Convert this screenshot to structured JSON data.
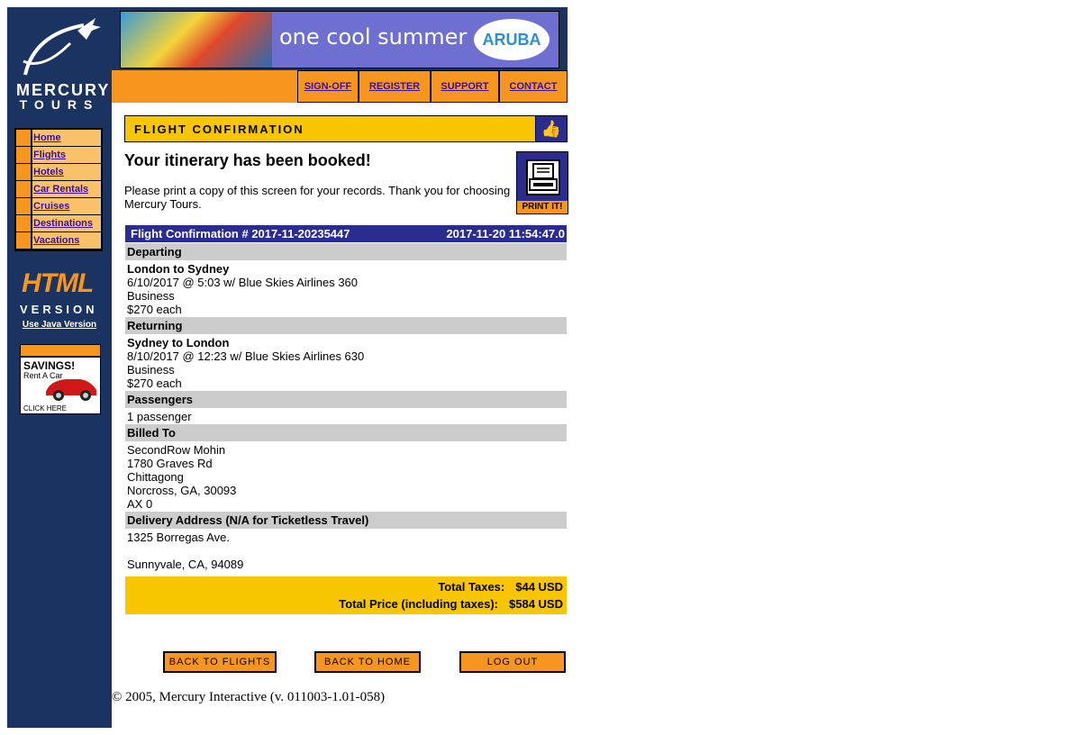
{
  "logo": {
    "line1": "MERCURY",
    "line2": "TOURS"
  },
  "nav": [
    {
      "label": "Home"
    },
    {
      "label": "Flights"
    },
    {
      "label": "Hotels"
    },
    {
      "label": "Car Rentals"
    },
    {
      "label": "Cruises"
    },
    {
      "label": "Destinations"
    },
    {
      "label": "Vacations"
    }
  ],
  "html_version": {
    "big": "HTML",
    "sub": "VERSION",
    "link": "Use Java Version"
  },
  "savings_ad": {
    "title": "SAVINGS!",
    "subtitle": "Rent A Car",
    "cta": "CLICK HERE"
  },
  "banner": {
    "text": "one cool summer",
    "brand": "ARUBA"
  },
  "topmenu": {
    "signoff": "SIGN-OFF",
    "register": "REGISTER",
    "support": "SUPPORT",
    "contact": "CONTACT"
  },
  "page_title": "FLIGHT CONFIRMATION",
  "booked_heading": "Your itinerary has been booked!",
  "print_message": "Please print a copy of this screen for your records. Thank you for choosing Mercury Tours.",
  "print_label": "PRINT IT!",
  "confirmation": {
    "number": "Flight Confirmation # 2017-11-20235447",
    "timestamp": "2017-11-20 11:54:47.0",
    "departing": {
      "header": "Departing",
      "route": "London to Sydney",
      "flight": "6/10/2017 @ 5:03 w/ Blue Skies Airlines 360",
      "class": "Business",
      "price": "$270 each"
    },
    "returning": {
      "header": "Returning",
      "route": "Sydney to London",
      "flight": "8/10/2017 @ 12:23 w/ Blue Skies Airlines 630",
      "class": "Business",
      "price": "$270 each"
    },
    "passengers": {
      "header": "Passengers",
      "value": "1 passenger"
    },
    "billed_to": {
      "header": "Billed To",
      "name": "SecondRow Mohin",
      "street": "1780 Graves Rd",
      "city": "Chittagong",
      "region": "Norcross, GA, 30093",
      "card": "AX 0"
    },
    "delivery": {
      "header": "Delivery Address (N/A for Ticketless Travel)",
      "street": "1325 Borregas Ave.",
      "city": "Sunnyvale, CA, 94089"
    },
    "totals": {
      "tax_label": "Total Taxes:",
      "tax_value": "$44 USD",
      "price_label": "Total Price (including taxes):",
      "price_value": "$584 USD"
    }
  },
  "buttons": {
    "back_flights": "BACK TO FLIGHTS",
    "back_home": "BACK TO HOME",
    "logout": "LOG OUT"
  },
  "footer": "© 2005, Mercury Interactive (v. 011003-1.01-058)",
  "colors": {
    "navy": "#1a3360",
    "orange": "#f7961e",
    "yellow": "#f7c600",
    "blue_header": "#2a2d8f",
    "gray_section": "#cccccc",
    "link": "#3b0fa0"
  }
}
